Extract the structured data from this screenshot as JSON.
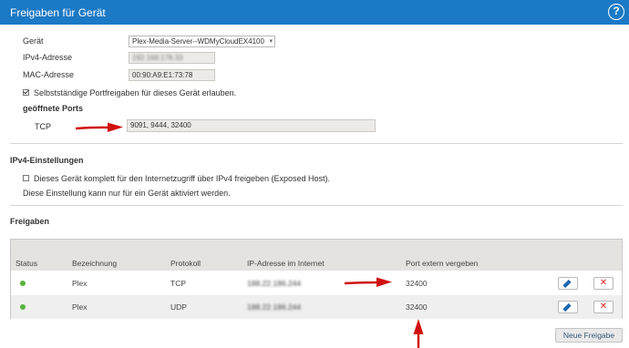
{
  "header": {
    "title": "Freigaben für Gerät",
    "help_glyph": "?"
  },
  "device": {
    "geraet_label": "Gerät",
    "geraet_value": "Plex-Media-Server--WDMyCloudEX4100",
    "ipv4_label": "IPv4-Adresse",
    "ipv4_value": "192.168.178.33",
    "mac_label": "MAC-Adresse",
    "mac_value": "00:90:A9:E1:73:78",
    "allow_label": "Selbstständige Portfreigaben für dieses Gerät erlauben.",
    "allow_checked": true,
    "open_ports_heading": "geöffnete Ports",
    "tcp_label": "TCP",
    "tcp_value": "9091, 9444, 32400"
  },
  "ipv4_settings": {
    "heading": "IPv4-Einstellungen",
    "exposed_label": "Dieses Gerät komplett für den Internetzugriff über IPv4 freigeben (Exposed Host).",
    "note": "Diese Einstellung kann nur für ein Gerät aktiviert werden."
  },
  "freigaben": {
    "heading": "Freigaben",
    "columns": [
      "Status",
      "Bezeichnung",
      "Protokoll",
      "IP-Adresse im Internet",
      "Port extern vergeben"
    ],
    "rows": [
      {
        "name": "Plex",
        "protocol": "TCP",
        "ip": "188.22.186.244",
        "port": "32400"
      },
      {
        "name": "Plex",
        "protocol": "UDP",
        "ip": "188.22.186.244",
        "port": "32400"
      }
    ],
    "delete_glyph": "✕",
    "new_button": "Neue Freigabe"
  },
  "colors": {
    "header_bg": "#1b79c5",
    "status_ok": "#57b33c",
    "arrow": "#d01010",
    "delete": "#d9241b"
  }
}
